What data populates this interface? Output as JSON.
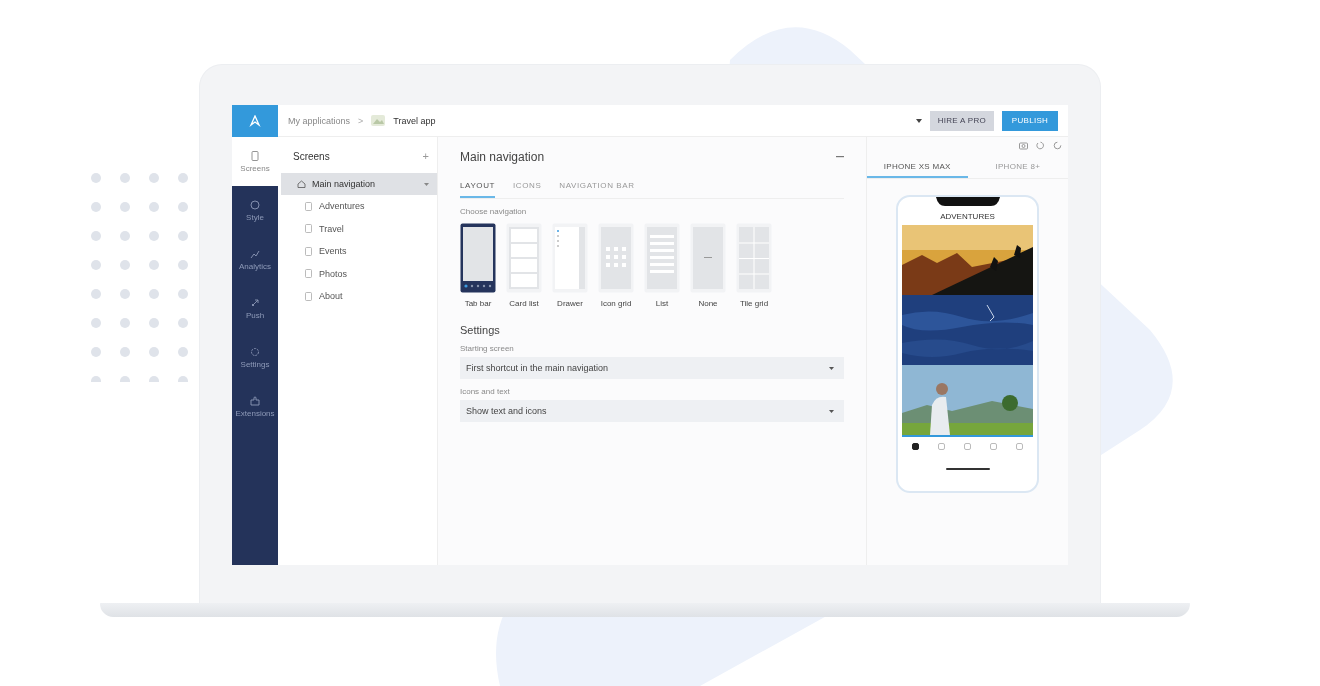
{
  "breadcrumb": {
    "parent": "My applications",
    "separator": ">",
    "app": "Travel app"
  },
  "top_actions": [
    {
      "label": "HIRE A PRO",
      "kind": "secondary"
    },
    {
      "label": "PUBLISH",
      "kind": "primary"
    }
  ],
  "rail": [
    {
      "label": "Screens",
      "selected": true
    },
    {
      "label": "Style",
      "selected": false
    },
    {
      "label": "Analytics",
      "selected": false
    },
    {
      "label": "Push",
      "selected": false
    },
    {
      "label": "Settings",
      "selected": false
    },
    {
      "label": "Extensions",
      "selected": false
    }
  ],
  "screens_panel": {
    "title": "Screens",
    "add": "+",
    "items": [
      {
        "label": "Main navigation",
        "selected": true,
        "children": [
          {
            "label": "Adventures",
            "selected": false
          },
          {
            "label": "Travel",
            "selected": false
          },
          {
            "label": "Events",
            "selected": false
          },
          {
            "label": "Photos",
            "selected": false
          },
          {
            "label": "About",
            "selected": false
          }
        ]
      }
    ]
  },
  "editor": {
    "title": "Main navigation",
    "tabs": [
      {
        "label": "LAYOUT",
        "selected": true
      },
      {
        "label": "ICONS",
        "selected": false
      },
      {
        "label": "NAVIGATION BAR",
        "selected": false
      }
    ],
    "choose_label": "Choose navigation",
    "layouts": [
      {
        "label": "Tab bar",
        "kind": "tabbar",
        "selected": true
      },
      {
        "label": "Card list",
        "kind": "cardlist",
        "selected": false
      },
      {
        "label": "Drawer",
        "kind": "drawer",
        "selected": false
      },
      {
        "label": "Icon grid",
        "kind": "icongrid",
        "selected": false
      },
      {
        "label": "List",
        "kind": "list",
        "selected": false
      },
      {
        "label": "None",
        "kind": "none",
        "selected": false
      },
      {
        "label": "Tile grid",
        "kind": "tilegrid",
        "selected": false
      }
    ],
    "settings_title": "Settings",
    "fields": [
      {
        "label": "Starting screen",
        "value": "First shortcut in the main navigation"
      },
      {
        "label": "Icons and text",
        "value": "Show text and icons"
      }
    ]
  },
  "preview": {
    "tabs": [
      {
        "label": "IPHONE XS MAX",
        "selected": true
      },
      {
        "label": "IPHONE 8+",
        "selected": false
      }
    ],
    "phone": {
      "title": "ADVENTURES",
      "tab_bar": [
        {
          "selected": true
        },
        {
          "selected": false
        },
        {
          "selected": false
        },
        {
          "selected": false
        },
        {
          "selected": false
        }
      ]
    }
  }
}
